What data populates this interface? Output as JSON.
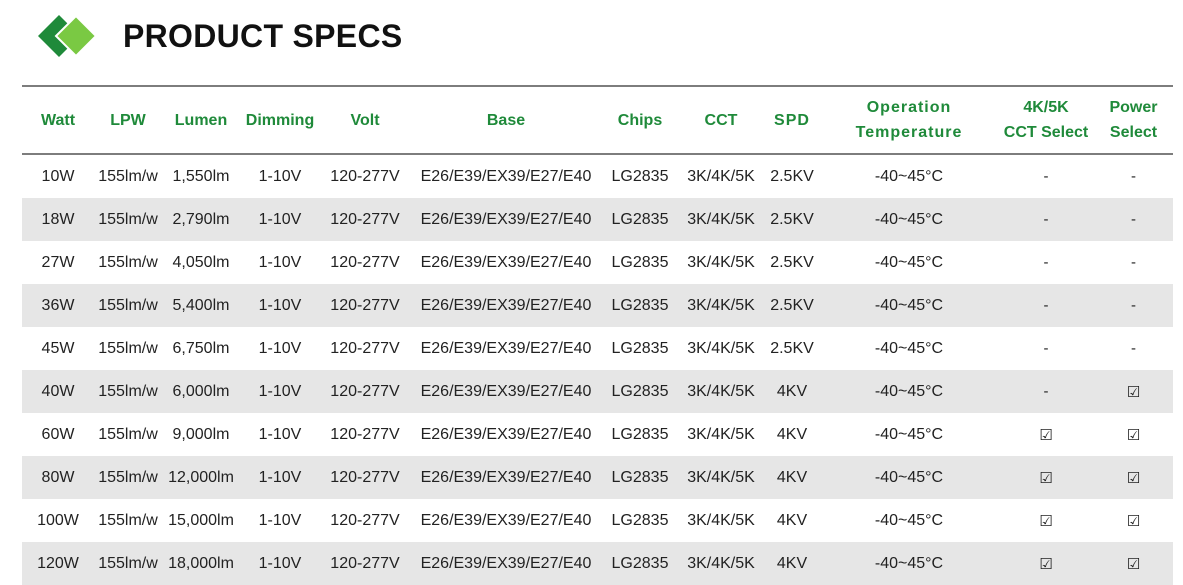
{
  "header": {
    "title": "PRODUCT SPECS",
    "logo_colors": [
      "#1f8a3a",
      "#7ac943"
    ]
  },
  "colors": {
    "header_text": "#1f8a3a",
    "stripe": "#e6e6e6",
    "rule": "#7d7d7d"
  },
  "table": {
    "columns": [
      {
        "line1": "Watt",
        "line2": ""
      },
      {
        "line1": "LPW",
        "line2": ""
      },
      {
        "line1": "Lumen",
        "line2": ""
      },
      {
        "line1": "Dimming",
        "line2": ""
      },
      {
        "line1": "Volt",
        "line2": ""
      },
      {
        "line1": "Base",
        "line2": ""
      },
      {
        "line1": "Chips",
        "line2": ""
      },
      {
        "line1": "CCT",
        "line2": ""
      },
      {
        "line1": "SPD",
        "line2": ""
      },
      {
        "line1": "Operation",
        "line2": "Temperature"
      },
      {
        "line1": "4K/5K",
        "line2": "CCT Select"
      },
      {
        "line1": "Power",
        "line2": "Select"
      }
    ],
    "rows": [
      [
        "10W",
        "155lm/w",
        "1,550lm",
        "1-10V",
        "120-277V",
        "E26/E39/EX39/E27/E40",
        "LG2835",
        "3K/4K/5K",
        "2.5KV",
        "-40~45°C",
        "-",
        "-"
      ],
      [
        "18W",
        "155lm/w",
        "2,790lm",
        "1-10V",
        "120-277V",
        "E26/E39/EX39/E27/E40",
        "LG2835",
        "3K/4K/5K",
        "2.5KV",
        "-40~45°C",
        "-",
        "-"
      ],
      [
        "27W",
        "155lm/w",
        "4,050lm",
        "1-10V",
        "120-277V",
        "E26/E39/EX39/E27/E40",
        "LG2835",
        "3K/4K/5K",
        "2.5KV",
        "-40~45°C",
        "-",
        "-"
      ],
      [
        "36W",
        "155lm/w",
        "5,400lm",
        "1-10V",
        "120-277V",
        "E26/E39/EX39/E27/E40",
        "LG2835",
        "3K/4K/5K",
        "2.5KV",
        "-40~45°C",
        "-",
        "-"
      ],
      [
        "45W",
        "155lm/w",
        "6,750lm",
        "1-10V",
        "120-277V",
        "E26/E39/EX39/E27/E40",
        "LG2835",
        "3K/4K/5K",
        "2.5KV",
        "-40~45°C",
        "-",
        "-"
      ],
      [
        "40W",
        "155lm/w",
        "6,000lm",
        "1-10V",
        "120-277V",
        "E26/E39/EX39/E27/E40",
        "LG2835",
        "3K/4K/5K",
        "4KV",
        "-40~45°C",
        "-",
        "☑"
      ],
      [
        "60W",
        "155lm/w",
        "9,000lm",
        "1-10V",
        "120-277V",
        "E26/E39/EX39/E27/E40",
        "LG2835",
        "3K/4K/5K",
        "4KV",
        "-40~45°C",
        "☑",
        "☑"
      ],
      [
        "80W",
        "155lm/w",
        "12,000lm",
        "1-10V",
        "120-277V",
        "E26/E39/EX39/E27/E40",
        "LG2835",
        "3K/4K/5K",
        "4KV",
        "-40~45°C",
        "☑",
        "☑"
      ],
      [
        "100W",
        "155lm/w",
        "15,000lm",
        "1-10V",
        "120-277V",
        "E26/E39/EX39/E27/E40",
        "LG2835",
        "3K/4K/5K",
        "4KV",
        "-40~45°C",
        "☑",
        "☑"
      ],
      [
        "120W",
        "155lm/w",
        "18,000lm",
        "1-10V",
        "120-277V",
        "E26/E39/EX39/E27/E40",
        "LG2835",
        "3K/4K/5K",
        "4KV",
        "-40~45°C",
        "☑",
        "☑"
      ]
    ]
  }
}
